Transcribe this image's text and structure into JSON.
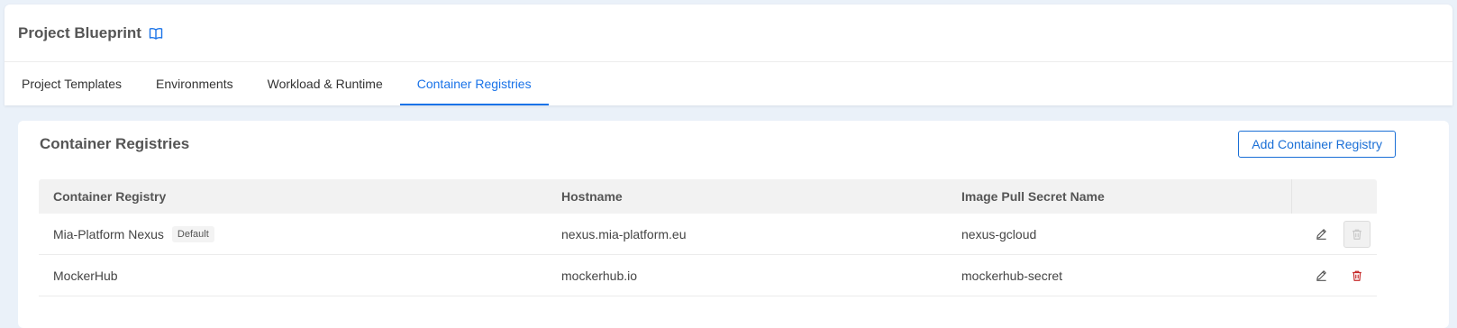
{
  "header": {
    "title": "Project Blueprint",
    "doc_icon": "book-open-icon",
    "tabs": [
      {
        "label": "Project Templates",
        "active": false
      },
      {
        "label": "Environments",
        "active": false
      },
      {
        "label": "Workload & Runtime",
        "active": false
      },
      {
        "label": "Container Registries",
        "active": true
      }
    ]
  },
  "section": {
    "title": "Container Registries",
    "add_button_label": "Add Container Registry"
  },
  "table": {
    "columns": [
      "Container Registry",
      "Hostname",
      "Image Pull Secret Name"
    ],
    "rows": [
      {
        "name": "Mia-Platform Nexus",
        "badge": "Default",
        "hostname": "nexus.mia-platform.eu",
        "secret": "nexus-gcloud",
        "delete_enabled": false
      },
      {
        "name": "MockerHub",
        "badge": "",
        "hostname": "mockerhub.io",
        "secret": "mockerhub-secret",
        "delete_enabled": true
      }
    ]
  },
  "colors": {
    "accent": "#1a73e8",
    "danger": "#c62828",
    "disabled": "#c8c8c8",
    "background": "#eaf1f9"
  }
}
